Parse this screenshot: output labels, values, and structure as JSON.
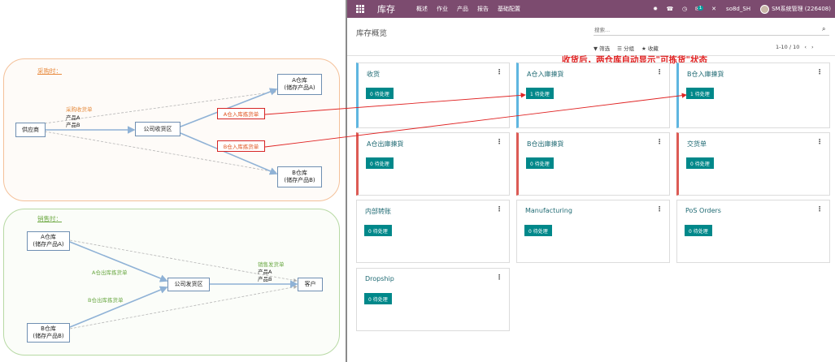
{
  "diagram": {
    "purchase_title": "采购时：",
    "sales_title": "销售时：",
    "boxes": {
      "supplier": "供应商",
      "company_receiving": "公司收货区",
      "warehouse_a_top": "A仓库\n(储存产品A)",
      "warehouse_b_top": "B仓库\n(储存产品B)",
      "warehouse_a_bottom": "A仓库\n(储存产品A)",
      "warehouse_b_bottom": "B仓库\n(储存产品B)",
      "company_shipping": "公司发货区",
      "customer": "客户"
    },
    "labels": {
      "purchase_receipt": "采购收货单",
      "product_a": "产品A",
      "product_b": "产品B",
      "a_in_pick": "A仓入库拣货单",
      "b_in_pick": "B仓入库拣货单",
      "a_out_pick": "A仓出库拣货单",
      "b_out_pick": "B仓出库拣货单",
      "sales_delivery": "销售发货单",
      "sales_product_a": "产品A",
      "sales_product_b": "产品B"
    },
    "colors": {
      "arrow": "#8fb2d6",
      "dashed": "#b5b5b5",
      "highlight": "#d62424"
    }
  },
  "navbar": {
    "app_title": "库存",
    "menus": [
      "概述",
      "作业",
      "产品",
      "报告",
      "基础配置"
    ],
    "chat_count": "1",
    "company": "so8d_SH",
    "user": "SM系统管理 (226408)",
    "bg_color": "#7c4b6f"
  },
  "control": {
    "breadcrumb": "库存概览",
    "search_placeholder": "搜索...",
    "filters_label": "筛选",
    "groupby_label": "分组",
    "favorites_label": "收藏",
    "pager": "1-10 / 10"
  },
  "annotation": "收货后，两仓库自动显示\"可拣货\"状态",
  "cards": [
    {
      "title": "收货",
      "button": "0 待处理",
      "accent": "blue"
    },
    {
      "title": "A仓入庫揀貨",
      "button": "1 待处理",
      "accent": "blue"
    },
    {
      "title": "B仓入庫揀貨",
      "button": "1 待处理",
      "accent": "blue"
    },
    {
      "title": "A仓出庫揀貨",
      "button": "0 待处理",
      "accent": "red"
    },
    {
      "title": "B仓出庫揀貨",
      "button": "0 待处理",
      "accent": "red"
    },
    {
      "title": "交货单",
      "button": "0 待处理",
      "accent": "red"
    },
    {
      "title": "内部转账",
      "button": "0 待处理",
      "accent": "plain"
    },
    {
      "title": "Manufacturing",
      "button": "0 待处理",
      "accent": "plain"
    },
    {
      "title": "PoS Orders",
      "button": "0 待处理",
      "accent": "plain"
    },
    {
      "title": "Dropship",
      "button": "0 待处理",
      "accent": "plain"
    }
  ]
}
